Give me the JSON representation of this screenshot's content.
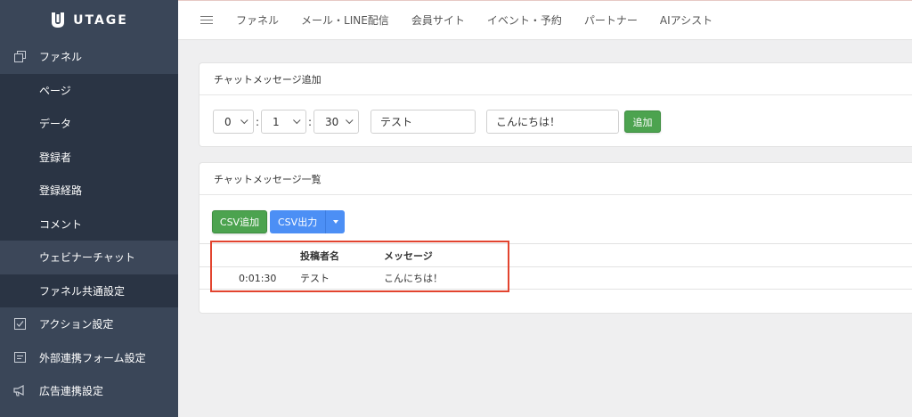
{
  "brand": {
    "name": "UTAGE"
  },
  "sidebar": {
    "items": [
      {
        "label": "ファネル",
        "icon": "copy-icon",
        "type": "top"
      },
      {
        "label": "ページ",
        "type": "sub"
      },
      {
        "label": "データ",
        "type": "sub"
      },
      {
        "label": "登録者",
        "type": "sub"
      },
      {
        "label": "登録経路",
        "type": "sub"
      },
      {
        "label": "コメント",
        "type": "sub"
      },
      {
        "label": "ウェビナーチャット",
        "type": "sub",
        "active": true
      },
      {
        "label": "ファネル共通設定",
        "type": "sub"
      },
      {
        "label": "アクション設定",
        "icon": "checkbox-icon",
        "type": "top"
      },
      {
        "label": "外部連携フォーム設定",
        "icon": "form-icon",
        "type": "top"
      },
      {
        "label": "広告連携設定",
        "icon": "megaphone-icon",
        "type": "top"
      }
    ]
  },
  "topnav": {
    "items": [
      "ファネル",
      "メール・LINE配信",
      "会員サイト",
      "イベント・予約",
      "パートナー",
      "AIアシスト"
    ]
  },
  "add_card": {
    "title": "チャットメッセージ追加",
    "hour": "0",
    "minute": "1",
    "second": "30",
    "sep": ":",
    "name_value": "テスト",
    "message_value": "こんにちは！",
    "add_button": "追加"
  },
  "list_card": {
    "title": "チャットメッセージ一覧",
    "csv_add": "CSV追加",
    "csv_export": "CSV出力",
    "table": {
      "headers": [
        "",
        "投稿者名",
        "メッセージ"
      ],
      "rows": [
        {
          "time": "0:01:30",
          "name": "テスト",
          "message": "こんにちは！"
        }
      ]
    }
  },
  "colors": {
    "sidebar_bg": "#3a4658",
    "sidebar_sub_bg": "#2a3444",
    "primary_green": "#4ca34f",
    "primary_blue": "#4c8ff5",
    "highlight_red": "#e2442f"
  }
}
